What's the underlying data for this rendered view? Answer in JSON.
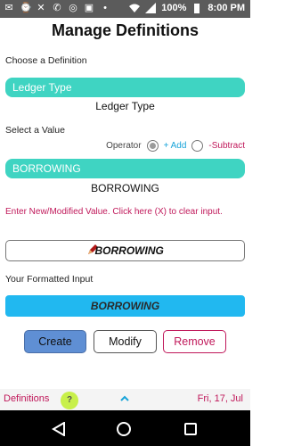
{
  "status": {
    "battery": "100%",
    "time": "8:00 PM"
  },
  "page_title": "Manage Definitions",
  "definition": {
    "label": "Choose a Definition",
    "selected": "Ledger Type",
    "display": "Ledger Type"
  },
  "value": {
    "label": "Select a Value",
    "operator_label": "Operator",
    "add_label": "+ Add",
    "subtract_label": "-Subtract",
    "selected": "BORROWING",
    "display": "BORROWING"
  },
  "instruction": "Enter New/Modified Value. Click here (X) to clear input.",
  "input": {
    "value": "BORROWING"
  },
  "formatted": {
    "label": "Your Formatted Input",
    "value": "BORROWING"
  },
  "buttons": {
    "create": "Create",
    "modify": "Modify",
    "remove": "Remove"
  },
  "bottom_bar": {
    "left": "Definitions",
    "help": "?",
    "date": "Fri, 17, Jul"
  },
  "colors": {
    "teal": "#3fd4c2",
    "blue": "#21b8f0",
    "accent": "#c0185a",
    "create_bg": "#5f8fd4"
  }
}
